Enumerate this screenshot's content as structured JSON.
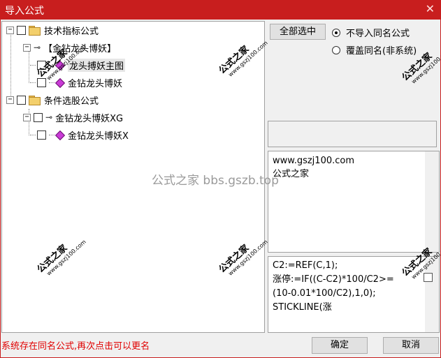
{
  "window": {
    "title": "导入公式",
    "close_glyph": "✕"
  },
  "tree": {
    "group_tech": {
      "label": "技术指标公式"
    },
    "formula_tech": {
      "label": "【金钻龙头博妖】"
    },
    "item_main": {
      "label": "龙头搏妖主图"
    },
    "item_sub": {
      "label": "金钻龙头博妖"
    },
    "group_pick": {
      "label": "条件选股公式"
    },
    "formula_pick": {
      "label": "金钻龙头博妖XG"
    },
    "item_pick": {
      "label": "金钻龙头博妖X"
    }
  },
  "options": {
    "select_all_label": "全部选中",
    "radio_skip_label": "不导入同名公式",
    "radio_overwrite_label": "覆盖同名(非系统)",
    "selected": "skip"
  },
  "description": {
    "line1": "www.gszj100.com",
    "line2": "公式之家"
  },
  "code": {
    "line1": "C2:=REF(C,1);",
    "line2": "涨停:=IF((C-C2)*100/C2>=",
    "line3": "(10-0.01*100/C2),1,0);",
    "line4": "STICKLINE(涨"
  },
  "status_text": "系统存在同名公式,再次点击可以更名",
  "buttons": {
    "ok_label": "确定",
    "cancel_label": "取消"
  },
  "watermark": {
    "main": "公式之家",
    "site": "www.gszj100.com",
    "center": "公式之家 bbs.gszb.top"
  },
  "colors": {
    "titlebar": "#c81e1e",
    "status": "#e00000",
    "gem": "#c93bd6",
    "folder": "#f3cf6b"
  }
}
